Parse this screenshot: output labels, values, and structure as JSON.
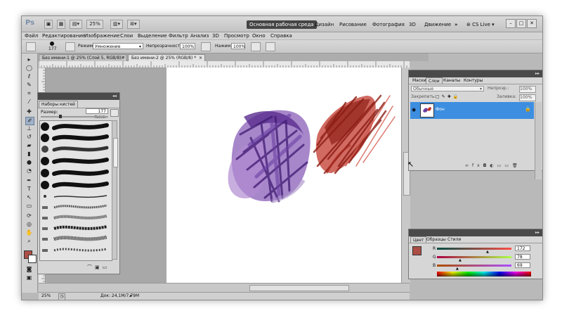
{
  "app": {
    "logo": "Ps",
    "zoom": "25%",
    "workspaces": [
      "Основная рабочая среда",
      "Дизайн",
      "Рисование",
      "Фотография",
      "3D",
      "Движение"
    ],
    "more": "»",
    "cs_live": "CS Live",
    "win_controls": [
      "–",
      "□",
      "✕"
    ]
  },
  "menu": [
    "Файл",
    "Редактирование",
    "Изображение",
    "Слои",
    "Выделение",
    "Фильтр",
    "Анализ",
    "3D",
    "Просмотр",
    "Окно",
    "Справка"
  ],
  "options": {
    "brush_size": "177",
    "mode_label": "Режим:",
    "mode_value": "Умножение",
    "opacity_label": "Непрозрачность:",
    "opacity_value": "100%",
    "pressure_label": "Нажим:",
    "pressure_value": "100%"
  },
  "tabs": [
    {
      "label": "Без имени-1 @ 25% (Слой 5, RGB/8) *",
      "close": "×"
    },
    {
      "label": "Без имени-2 @ 25% (RGB/8) *",
      "close": "×"
    }
  ],
  "brush_panel": {
    "title": "Наборы кистей",
    "size_label": "Размер:",
    "size_value": "177 пикс."
  },
  "layers_panel": {
    "tabs": [
      "Маски",
      "Слои",
      "Каналы",
      "Контуры"
    ],
    "blend": "Обычные",
    "opacity_label": "Непрозр.:",
    "opacity_value": "100%",
    "lock_label": "Закрепить:",
    "fill_label": "Заливка:",
    "fill_value": "100%",
    "layer_name": "Фон",
    "bottom_icons": [
      "∞",
      "fx",
      "◘",
      "◐",
      "▭",
      "▭",
      "🗑"
    ]
  },
  "color_panel": {
    "tabs": [
      "Цвет",
      "Образцы",
      "Стили"
    ],
    "r_label": "R",
    "g_label": "G",
    "b_label": "B",
    "r_value": "172",
    "g_value": "78",
    "b_value": "69",
    "fg_color": "#ac4e45"
  },
  "status": {
    "zoom": "25%",
    "doc": "Док: 24,1M/7,79M"
  }
}
